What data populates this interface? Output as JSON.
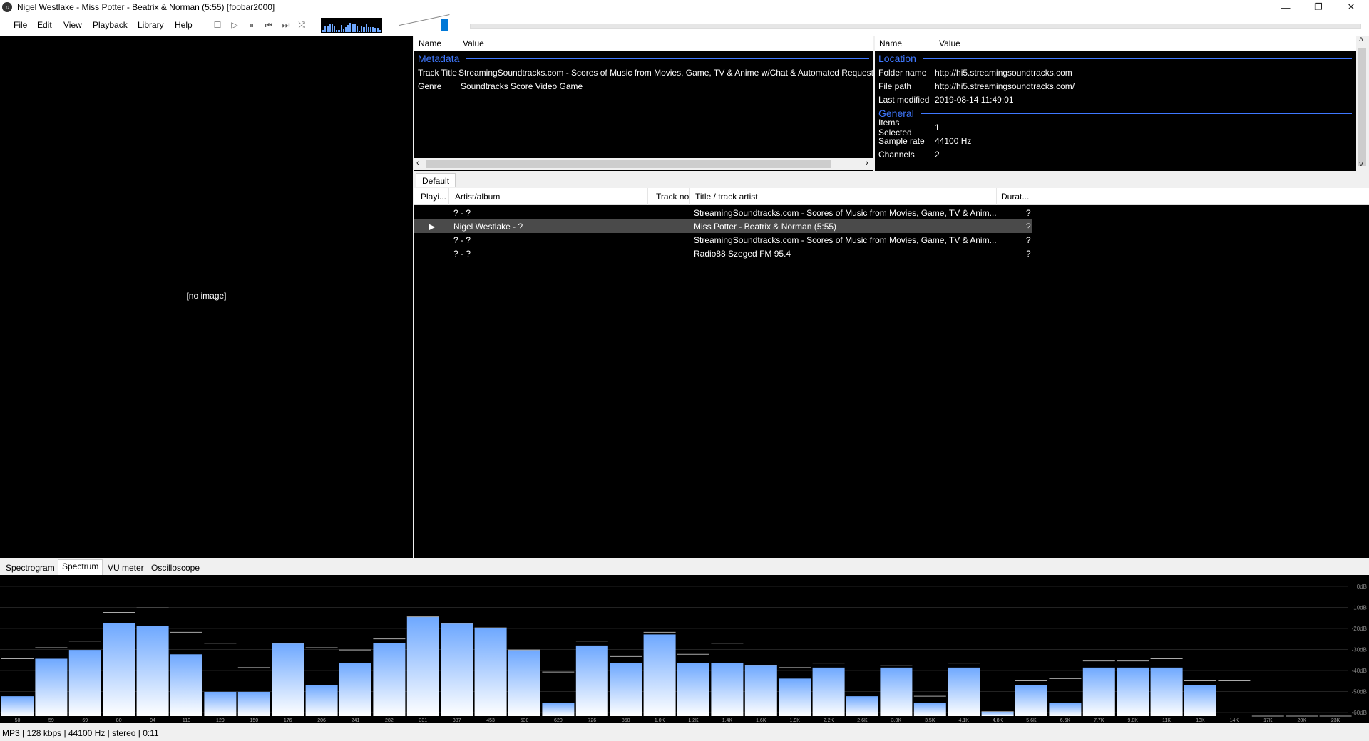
{
  "window": {
    "title": "Nigel Westlake - Miss Potter - Beatrix & Norman (5:55)  [foobar2000]",
    "minimize": "—",
    "restore": "❐",
    "close": "✕"
  },
  "menu": [
    "File",
    "Edit",
    "View",
    "Playback",
    "Library",
    "Help"
  ],
  "toolbar": {
    "buttons": [
      "stop-icon",
      "play-icon",
      "pause-icon",
      "previous-icon",
      "next-icon",
      "random-icon"
    ],
    "glyphs": [
      "☐",
      "▷",
      "⏸",
      "⏮",
      "⏭",
      "⤮"
    ]
  },
  "albumart": {
    "text": "[no image]"
  },
  "props_left": {
    "col_name": "Name",
    "col_value": "Value",
    "section": "Metadata",
    "rows": [
      {
        "name": "Track Title",
        "value": "StreamingSoundtracks.com - Scores of Music from Movies, Game, TV & Anime w/Chat & Automated Request"
      },
      {
        "name": "Genre",
        "value": "Soundtracks Score Video Game"
      }
    ]
  },
  "props_right": {
    "col_name": "Name",
    "col_value": "Value",
    "location_title": "Location",
    "location_rows": [
      {
        "name": "Folder name",
        "value": "http://hi5.streamingsoundtracks.com"
      },
      {
        "name": "File path",
        "value": "http://hi5.streamingsoundtracks.com/"
      },
      {
        "name": "Last modified",
        "value": "2019-08-14 11:49:01"
      }
    ],
    "general_title": "General",
    "general_rows": [
      {
        "name": "Items Selected",
        "value": "1"
      },
      {
        "name": "Sample rate",
        "value": "44100 Hz"
      },
      {
        "name": "Channels",
        "value": "2"
      }
    ]
  },
  "playlist": {
    "tab": "Default",
    "columns": [
      "Playi...",
      "Artist/album",
      "Track no",
      "Title / track artist",
      "Durat..."
    ],
    "rows": [
      {
        "playing": "",
        "artist": "? - ?",
        "track": "",
        "title": "StreamingSoundtracks.com - Scores of Music from Movies, Game, TV & Anim...",
        "duration": "?"
      },
      {
        "playing": "▶",
        "artist": "Nigel Westlake - ?",
        "track": "",
        "title": "Miss Potter - Beatrix & Norman (5:55)",
        "duration": "?"
      },
      {
        "playing": "",
        "artist": "? - ?",
        "track": "",
        "title": "StreamingSoundtracks.com - Scores of Music from Movies, Game, TV & Anim...",
        "duration": "?"
      },
      {
        "playing": "",
        "artist": "? - ?",
        "track": "",
        "title": "Radio88 Szeged FM 95.4",
        "duration": "?"
      }
    ]
  },
  "vis_tabs": [
    "Spectrogram",
    "Spectrum",
    "VU meter",
    "Oscilloscope"
  ],
  "spectrum": {
    "freq_labels": [
      "50",
      "59",
      "69",
      "80",
      "94",
      "110",
      "129",
      "150",
      "176",
      "206",
      "241",
      "282",
      "331",
      "387",
      "453",
      "530",
      "620",
      "726",
      "850",
      "1.0K",
      "1.2K",
      "1.4K",
      "1.6K",
      "1.9K",
      "2.2K",
      "2.6K",
      "3.0K",
      "3.5K",
      "4.1K",
      "4.8K",
      "5.6K",
      "6.6K",
      "7.7K",
      "9.0K",
      "11K",
      "13K",
      "14K",
      "17K",
      "20K",
      "23K"
    ],
    "db_labels": [
      "0dB",
      "-10dB",
      "-20dB",
      "-30dB",
      "-40dB",
      "-50dB",
      "-60dB"
    ],
    "levels_db": [
      -53,
      -36,
      -32,
      -20,
      -21,
      -34,
      -51,
      -51,
      -29,
      -48,
      -38,
      -29,
      -17,
      -20,
      -22,
      -32,
      -56,
      -30,
      -38,
      -25,
      -38,
      -38,
      -39,
      -45,
      -40,
      -53,
      -40,
      -56,
      -40,
      -60,
      -48,
      -56,
      -40,
      -40,
      -40,
      -48,
      -62,
      -62,
      -62,
      -62
    ],
    "peaks_db": [
      -36,
      -31,
      -28,
      -15,
      -13,
      -24,
      -29,
      -40,
      -29,
      -31,
      -32,
      -27,
      -17,
      -20,
      -22,
      -32,
      -42,
      -28,
      -35,
      -24,
      -34,
      -29,
      -39,
      -40,
      -38,
      -47,
      -39,
      -53,
      -38,
      -60,
      -46,
      -45,
      -37,
      -37,
      -36,
      -46,
      -46,
      -62,
      -62,
      -62
    ],
    "bar_color": "#6ea8ff"
  },
  "status": "MP3 | 128 kbps | 44100 Hz | stereo | 0:11"
}
